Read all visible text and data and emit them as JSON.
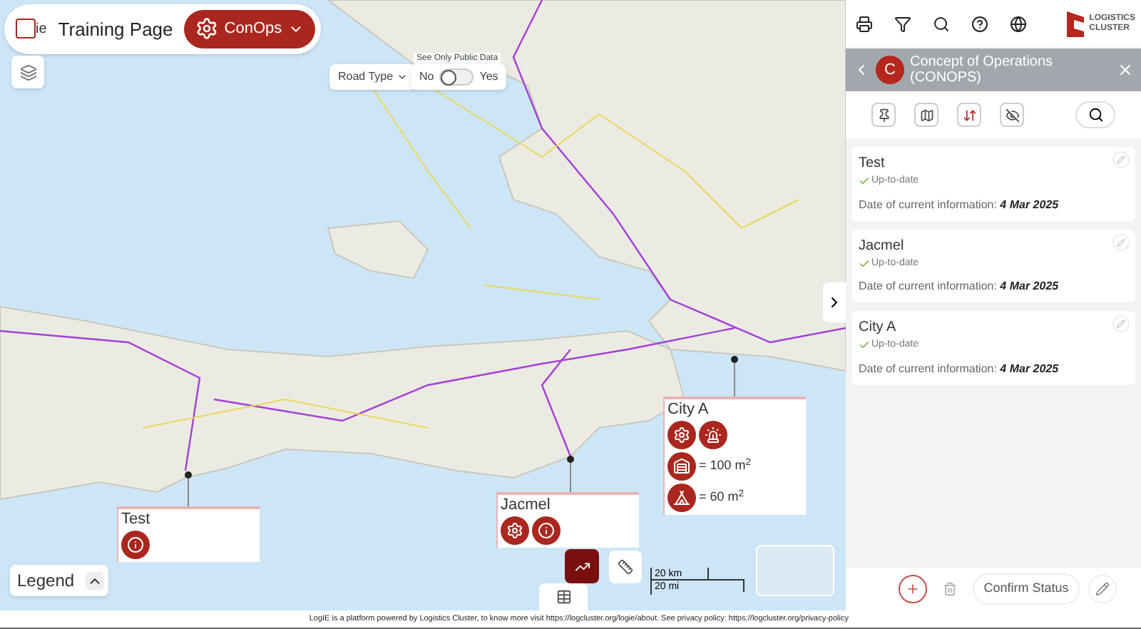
{
  "header": {
    "logo_text": "ie",
    "title": "Training Page",
    "menu": {
      "label": "ConOps"
    }
  },
  "filters": {
    "road_type": {
      "label": "Road Type"
    },
    "public_data": {
      "caption": "See Only Public Data",
      "off_label": "No",
      "on_label": "Yes",
      "on": false
    }
  },
  "map_markers": [
    {
      "name": "Test",
      "items": [
        {
          "kind": "info"
        }
      ]
    },
    {
      "name": "Jacmel",
      "items": [
        {
          "kind": "gear"
        },
        {
          "kind": "info"
        }
      ]
    },
    {
      "name": "City A",
      "items": [
        {
          "kind": "gear"
        },
        {
          "kind": "alert"
        },
        {
          "kind": "warehouse",
          "text": "= 100 m$^{2}$"
        },
        {
          "kind": "tent",
          "text": "= 60 m$^{2}$"
        }
      ]
    }
  ],
  "legend": {
    "label": "Legend"
  },
  "scale": {
    "km": "20 km",
    "mi": "20 mi"
  },
  "footer": "LogIE is a platform powered by Logistics Cluster, to know more visit https://logcluster.org/logie/about. See privacy policy: https://logcluster.org/privacy-policy",
  "brand": {
    "line1": "LOGISTICS",
    "line2": "CLUSTER"
  },
  "panel": {
    "avatar": "C",
    "title": "Concept of Operations (CONOPS)",
    "cards": [
      {
        "name": "Test",
        "status": "Up-to-date",
        "date_label": "Date of current information:",
        "date": "4 Mar 2025"
      },
      {
        "name": "Jacmel",
        "status": "Up-to-date",
        "date_label": "Date of current information:",
        "date": "4 Mar 2025"
      },
      {
        "name": "City A",
        "status": "Up-to-date",
        "date_label": "Date of current information:",
        "date": "4 Mar 2025"
      }
    ],
    "confirm_button": "Confirm Status"
  }
}
